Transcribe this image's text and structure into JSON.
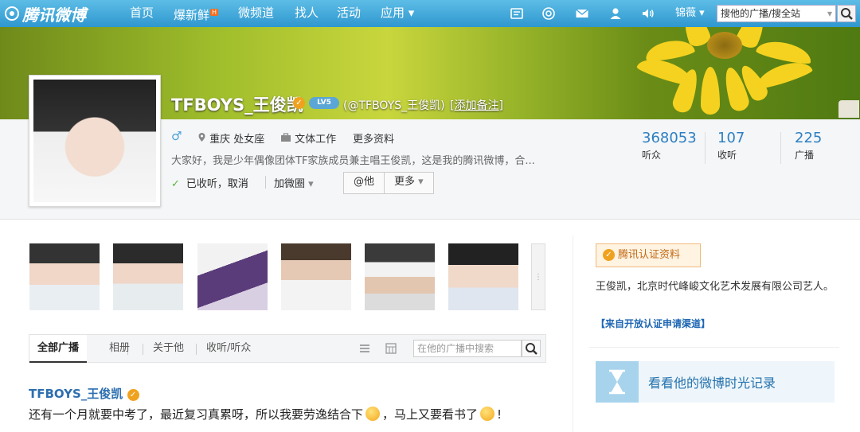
{
  "topbar": {
    "logo": "腾讯微博",
    "nav": [
      "首页",
      "爆新鲜",
      "微频道",
      "找人",
      "活动",
      "应用"
    ],
    "new_badge": "H",
    "user_menu": "锦薇",
    "search_placeholder": "搜他的广播/搜全站"
  },
  "profile": {
    "name": "TFBOYS_王俊凯",
    "level": "LV5",
    "handle": "(@TFBOYS_王俊凯)",
    "add_remark": "[添加备注]",
    "gender_icon": "♂",
    "location": "重庆 处女座",
    "work": "文体工作",
    "more_info": "更多资料",
    "bio": "大家好，我是少年偶像团体TF家族成员兼主唱王俊凯，这是我的腾讯微博，合...",
    "follow_status": "已收听，",
    "cancel": "取消",
    "add_circle": "加微圈",
    "at_button": "@他",
    "more_button": "更多"
  },
  "stats": [
    {
      "value": "368053",
      "label": "听众"
    },
    {
      "value": "107",
      "label": "收听"
    },
    {
      "value": "225",
      "label": "广播"
    }
  ],
  "tabs": {
    "items": [
      "全部广播",
      "相册",
      "关于他",
      "收听/听众"
    ],
    "search_placeholder": "在他的广播中搜索"
  },
  "post": {
    "author": "TFBOYS_王俊凯",
    "text_1": "还有一个月就要中考了，最近复习真累呀，所以我要劳逸结合下",
    "text_2": "，马上又要看书了",
    "text_3": "!"
  },
  "sidebar": {
    "verify_tag": "腾讯认证资料",
    "verify_desc": "王俊凯，北京时代峰峻文化艺术发展有限公司艺人。",
    "verify_source": "【来自开放认证申请渠道】",
    "timeline": "看看他的微博时光记录"
  },
  "colors": {
    "nav_bar": "#3fa6d8",
    "link_blue": "#2d7fc2",
    "verified": "#f0a21e"
  },
  "icons": [
    "logo-icon",
    "message-icon",
    "at-icon",
    "mail-icon",
    "user-icon",
    "sound-icon",
    "search-icon",
    "verified-icon",
    "location-icon",
    "work-icon",
    "check-icon",
    "list-view-icon",
    "grid-view-icon",
    "hourglass-icon"
  ]
}
